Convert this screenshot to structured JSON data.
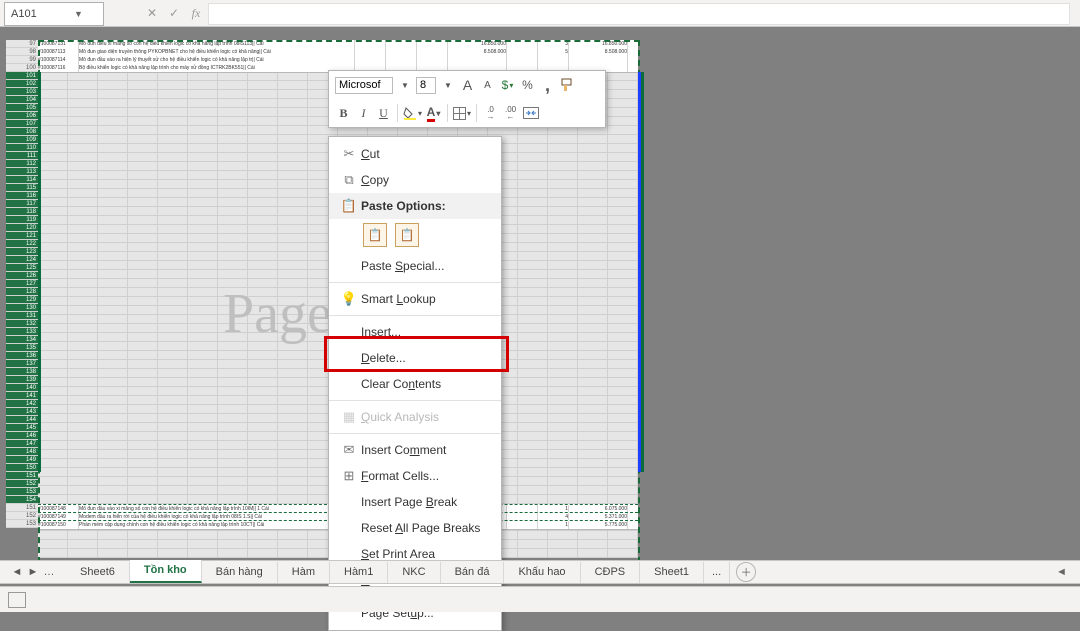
{
  "formula_bar": {
    "cell_ref": "A101",
    "fx_label": "fx"
  },
  "rows": {
    "data_top": [
      {
        "num": "97",
        "a": "#100087131",
        "b": "Mô đun điều xi măng số con hệ điều khiển logic có khả năng lập trình 08IS113|| Cái",
        "f": "16.850.000",
        "h": "3",
        "i": "16.850.000"
      },
      {
        "num": "98",
        "a": "#100087113",
        "b": "Mô đun giao diện truyền thông PYKOPBNET cho hệ điều khiển logic có khả năng|| Cái",
        "f": "8.508.000",
        "h": "5",
        "i": "8.508.000"
      },
      {
        "num": "99",
        "a": "#100087114",
        "b": "Mô đun đầu vào ra hiện lý thuyết xử cho hệ điều khiển logic có khả năng lập tr|| Cái",
        "f": "",
        "h": "",
        "i": ""
      },
      {
        "num": "100",
        "a": "#100087116",
        "b": "Bộ điều khiển logic có khả năng lập trình cho máy xử đồng ICTRK2BK551|| Cái",
        "f": "",
        "h": "",
        "i": ""
      }
    ],
    "selected_start": 101,
    "selected_end": 150,
    "data_bottom": [
      {
        "num": "151",
        "a": "#100087148",
        "b": "Mô đun đầu vào xi măng số con hệ điều khiển logic có khả năng lập trình 10IM|| 1 Cái",
        "f": "",
        "h": "1",
        "i": "6.075.000"
      },
      {
        "num": "152",
        "a": "#100087149",
        "b": "Modem đầu ra hiển rời của hệ điều khiển logic có khả năng lập trình 08IS 1.S|| Cái",
        "f": "",
        "h": "4",
        "i": "5.371.000"
      },
      {
        "num": "153",
        "a": "#100087150",
        "b": "Phần mềm cập dụng chính con hệ điều khiển logic có khả năng lập trình 10CT|| Cái",
        "f": "",
        "h": "1",
        "i": "5.775.000"
      }
    ]
  },
  "watermark": "Page",
  "mini_toolbar": {
    "font_name": "Microsof",
    "font_size": "8",
    "increase_font": "A",
    "decrease_font": "A",
    "percent": "%",
    "comma": ",",
    "bold": "B",
    "italic": "I",
    "underline": "U",
    "inc_dec_top": ".0",
    "inc_dec_bot": ".00"
  },
  "context_menu": {
    "cut": "Cut",
    "copy": "Copy",
    "paste_options": "Paste Options:",
    "paste_special": "Paste Special...",
    "smart_lookup": "Smart Lookup",
    "insert": "Insert...",
    "delete": "Delete...",
    "clear_contents": "Clear Contents",
    "quick_analysis": "Quick Analysis",
    "insert_comment": "Insert Comment",
    "format_cells": "Format Cells...",
    "insert_page_break": "Insert Page Break",
    "reset_all_page_breaks": "Reset All Page Breaks",
    "set_print_area": "Set Print Area",
    "reset_print_area": "Reset Print Area",
    "page_setup": "Page Setup..."
  },
  "tabs": {
    "left": "Sheet6",
    "active": "Tồn kho",
    "right_partial": "Bán hàng",
    "others": [
      "Hàm",
      "Hàm1",
      "NKC",
      "Bán đá",
      "Khấu hao",
      "CĐPS",
      "Sheet1"
    ],
    "ellipsis": "..."
  },
  "colors": {
    "accent": "#217346",
    "highlight": "#d40000",
    "selection_border": "#0a6b3c"
  }
}
